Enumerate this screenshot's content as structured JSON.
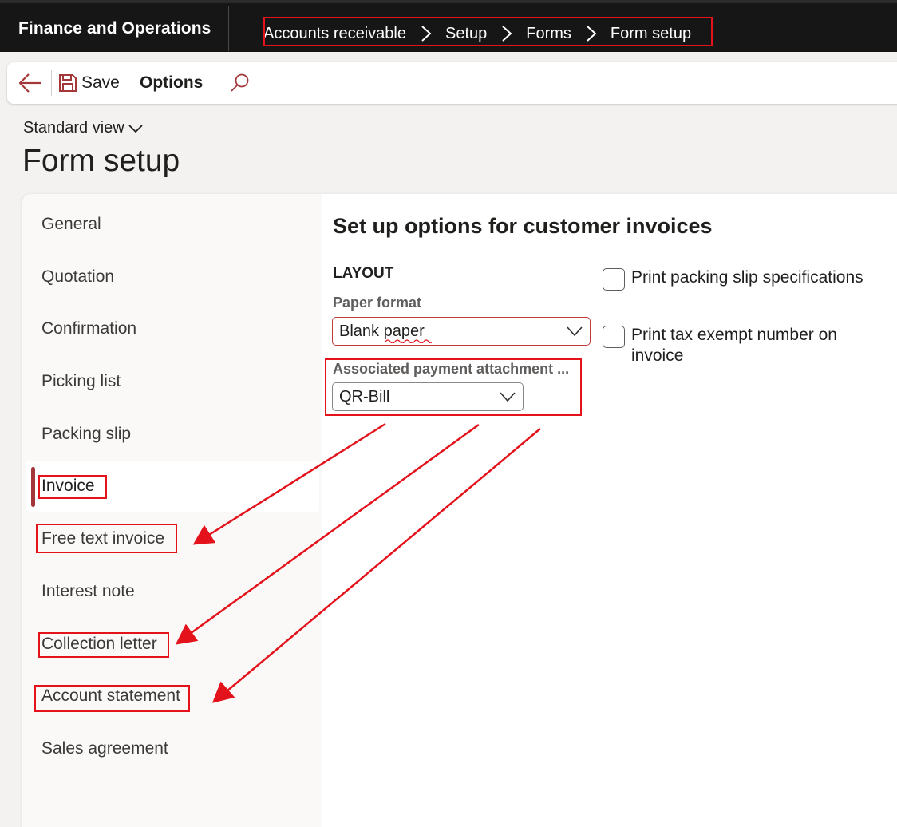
{
  "app": {
    "title": "Finance and Operations"
  },
  "breadcrumb": [
    "Accounts receivable",
    "Setup",
    "Forms",
    "Form setup"
  ],
  "toolbar": {
    "save_label": "Save",
    "options_label": "Options"
  },
  "view": {
    "label": "Standard view"
  },
  "page": {
    "title": "Form setup"
  },
  "nav": {
    "items": [
      "General",
      "Quotation",
      "Confirmation",
      "Picking list",
      "Packing slip",
      "Invoice",
      "Free text invoice",
      "Interest note",
      "Collection letter",
      "Account statement",
      "Sales agreement"
    ],
    "selected": "Invoice"
  },
  "section": {
    "heading": "Set up options for customer invoices",
    "group": "LAYOUT",
    "paper_format": {
      "label": "Paper format",
      "value": "Blank paper"
    },
    "payment_attachment": {
      "label": "Associated payment attachment ...",
      "value": "QR-Bill"
    },
    "checkboxes": [
      {
        "label": "Print packing slip specifications",
        "checked": false
      },
      {
        "label": "Print tax exempt number on invoice",
        "checked": false
      }
    ]
  },
  "colors": {
    "accent": "#a4373a",
    "annotation": "#e3121b",
    "nav_bar": "#161616"
  }
}
